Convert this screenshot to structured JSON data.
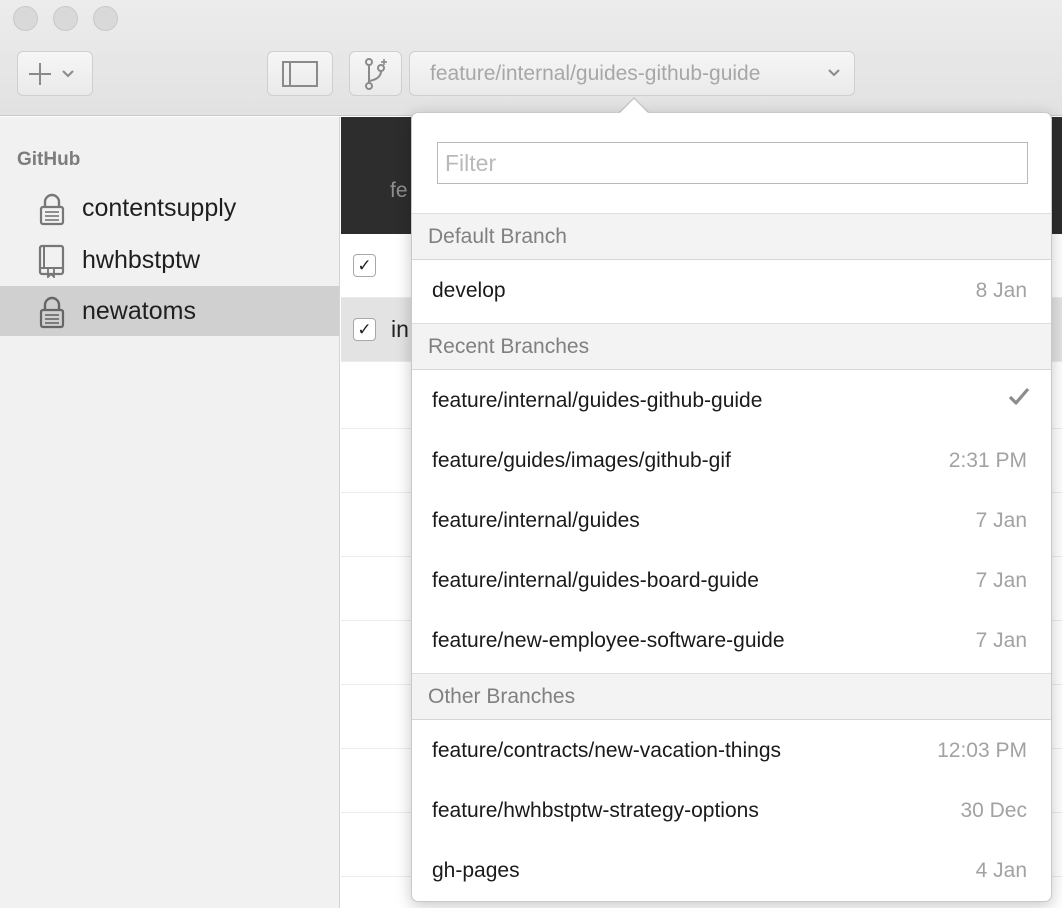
{
  "toolbar": {
    "add_icon": "plus-icon",
    "sidebar_toggle_icon": "sidebar-icon",
    "branch_icon": "branch-icon",
    "current_branch": "feature/internal/guides-github-guide"
  },
  "sidebar": {
    "heading": "GitHub",
    "repos": [
      {
        "label": "contentsupply",
        "icon": "lock-icon"
      },
      {
        "label": "hwhbstptw",
        "icon": "book-icon"
      },
      {
        "label": "newatoms",
        "icon": "lock-icon",
        "selected": true
      }
    ]
  },
  "main": {
    "header_text": "fe",
    "row_text": "in"
  },
  "popover": {
    "filter_placeholder": "Filter",
    "default_section": "Default Branch",
    "default_branches": [
      {
        "name": "develop",
        "date": "8 Jan"
      }
    ],
    "recent_section": "Recent Branches",
    "recent_branches": [
      {
        "name": "feature/internal/guides-github-guide",
        "date": "",
        "current": true
      },
      {
        "name": "feature/guides/images/github-gif",
        "date": "2:31 PM"
      },
      {
        "name": "feature/internal/guides",
        "date": "7 Jan"
      },
      {
        "name": "feature/internal/guides-board-guide",
        "date": "7 Jan"
      },
      {
        "name": "feature/new-employee-software-guide",
        "date": "7 Jan"
      }
    ],
    "other_section": "Other Branches",
    "other_branches": [
      {
        "name": "feature/contracts/new-vacation-things",
        "date": "12:03 PM"
      },
      {
        "name": "feature/hwhbstptw-strategy-options",
        "date": "30 Dec"
      },
      {
        "name": "gh-pages",
        "date": "4 Jan"
      }
    ]
  },
  "colors": {
    "toolbar_bg": "#e6e6e6",
    "sidebar_bg": "#f1f1f1",
    "selected_repo_bg": "#d0d0d0",
    "main_header_bg": "#2d2d2d",
    "secondary_text": "#a2a2a2"
  }
}
